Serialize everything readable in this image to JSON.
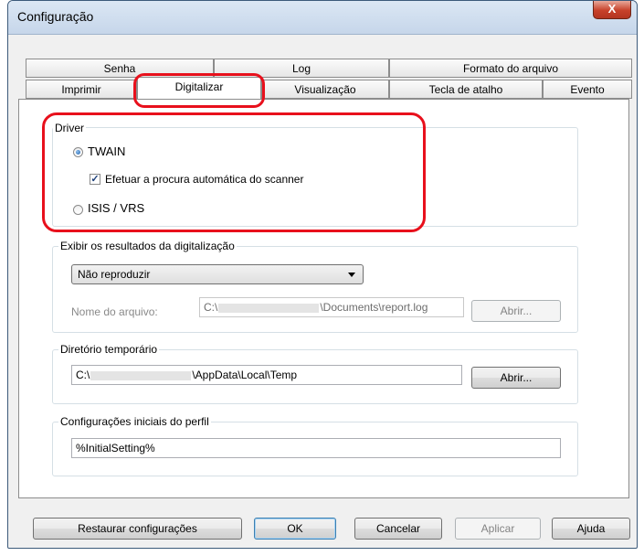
{
  "window": {
    "title": "Configuração",
    "close_label": "X"
  },
  "tabs_row1": [
    {
      "label": "Senha"
    },
    {
      "label": "Log"
    },
    {
      "label": "Formato do arquivo"
    }
  ],
  "tabs_row2": [
    {
      "label": "Imprimir"
    },
    {
      "label": "Digitalizar",
      "active": true
    },
    {
      "label": "Visualização"
    },
    {
      "label": "Tecla de atalho"
    },
    {
      "label": "Evento"
    }
  ],
  "driver": {
    "legend": "Driver",
    "twain_label": "TWAIN",
    "twain_selected": true,
    "auto_search_label": "Efetuar a procura automática do scanner",
    "auto_search_checked": true,
    "isis_label": "ISIS / VRS",
    "isis_selected": false
  },
  "results": {
    "legend": "Exibir os resultados da digitalização",
    "selected_option": "Não reproduzir",
    "file_name_label": "Nome do arquivo:",
    "file_path_prefix": "C:\\",
    "file_path_suffix": "\\Documents\\report.log",
    "open_label": "Abrir..."
  },
  "temp_dir": {
    "legend": "Diretório temporário",
    "path_prefix": "C:\\",
    "path_suffix": "\\AppData\\Local\\Temp",
    "open_label": "Abrir..."
  },
  "profile": {
    "legend": "Configurações iniciais do perfil",
    "value": "%InitialSetting%"
  },
  "footer": {
    "restore_label": "Restaurar configurações",
    "ok_label": "OK",
    "cancel_label": "Cancelar",
    "apply_label": "Aplicar",
    "help_label": "Ajuda"
  },
  "colors": {
    "highlight": "#e8101c",
    "close_button": "#c7412a"
  }
}
